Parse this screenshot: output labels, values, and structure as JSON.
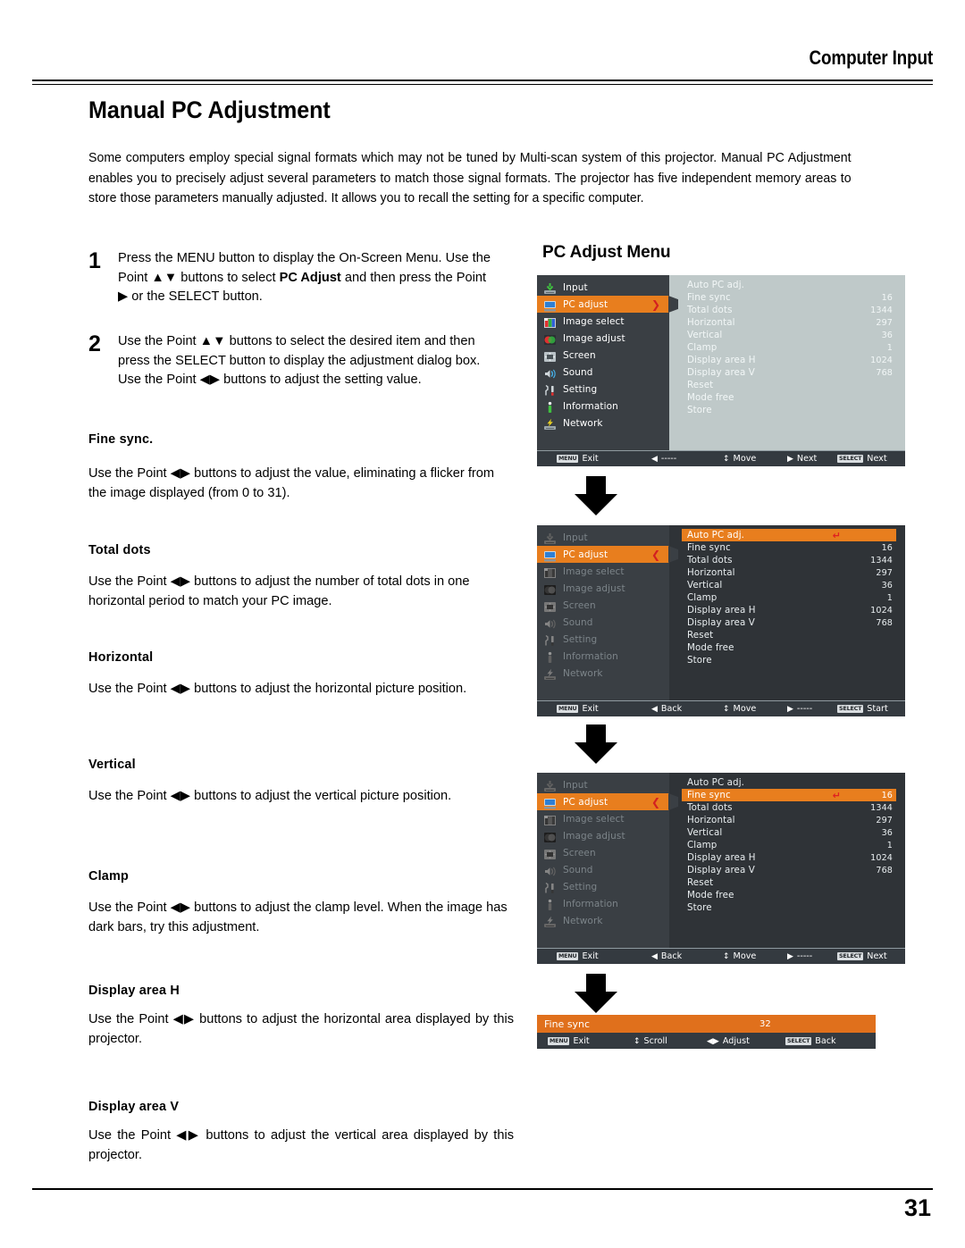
{
  "header": {
    "title": "Computer Input"
  },
  "page": {
    "main_title": "Manual PC Adjustment",
    "number": "31"
  },
  "intro": "Some computers employ special signal formats which may not be tuned by Multi-scan system of this projector. Manual PC Adjustment enables you to precisely adjust several parameters to match those signal formats. The projector has five independent memory areas to store those parameters manually adjusted. It allows you to recall the setting for a specific computer.",
  "steps": [
    {
      "number": "1",
      "part1": "Press the MENU button to display the On-Screen Menu. Use the Point ",
      "glyph1": "▲▼",
      "part2": " buttons to select ",
      "bold": "PC Adjust",
      "part3": " and then press the Point ",
      "glyph2": "▶",
      "part4": " or the SELECT button."
    },
    {
      "number": "2",
      "part1": "Use the Point ",
      "glyph1": "▲▼",
      "part2": " buttons to select  the desired item and then press the SELECT button to display the adjustment dialog box. Use the Point ",
      "glyph2": "◀▶",
      "part3": " buttons to adjust the setting value."
    }
  ],
  "sections": [
    {
      "heading": "Fine sync.",
      "pre": "Use the Point ",
      "glyph": "◀▶",
      "post": " buttons to adjust the value, eliminating a flicker from the image displayed (from 0 to 31)."
    },
    {
      "heading": "Total dots",
      "pre": "Use the Point ",
      "glyph": "◀▶",
      "post": " buttons to adjust the number of total dots in one horizontal period to match your PC image."
    },
    {
      "heading": "Horizontal",
      "pre": "Use the Point ",
      "glyph": "◀▶",
      "post": " buttons to adjust the horizontal picture position."
    },
    {
      "heading": "Vertical",
      "pre": "Use the Point ",
      "glyph": "◀▶",
      "post": " buttons to adjust the vertical picture position."
    },
    {
      "heading": "Clamp",
      "pre": "Use the Point ",
      "glyph": "◀▶",
      "post": " buttons to adjust the clamp level. When the image has dark bars, try this adjustment."
    },
    {
      "heading": "Display area H",
      "pre": "Use the Point ",
      "glyph": "◀▶",
      "post": " buttons to adjust the horizontal area displayed by this projector."
    },
    {
      "heading": "Display area V",
      "pre": "Use the Point ",
      "glyph": "◀▶",
      "post": " buttons to adjust the vertical area displayed by this projector."
    }
  ],
  "osd": {
    "title": "PC Adjust Menu",
    "sidebar_items": [
      {
        "label": "Input",
        "icon": "input-icon"
      },
      {
        "label": "PC adjust",
        "icon": "pc-adjust-icon"
      },
      {
        "label": "Image select",
        "icon": "image-select-icon"
      },
      {
        "label": "Image adjust",
        "icon": "image-adjust-icon"
      },
      {
        "label": "Screen",
        "icon": "screen-icon"
      },
      {
        "label": "Sound",
        "icon": "sound-icon"
      },
      {
        "label": "Setting",
        "icon": "setting-icon"
      },
      {
        "label": "Information",
        "icon": "information-icon"
      },
      {
        "label": "Network",
        "icon": "network-icon"
      }
    ],
    "items": [
      {
        "label": "Auto PC adj.",
        "value": ""
      },
      {
        "label": "Fine sync",
        "value": "16"
      },
      {
        "label": "Total dots",
        "value": "1344"
      },
      {
        "label": "Horizontal",
        "value": "297"
      },
      {
        "label": "Vertical",
        "value": "36"
      },
      {
        "label": "Clamp",
        "value": "1"
      },
      {
        "label": "Display area H",
        "value": "1024"
      },
      {
        "label": "Display area V",
        "value": "768"
      },
      {
        "label": "Reset",
        "value": ""
      },
      {
        "label": "Mode free",
        "value": ""
      },
      {
        "label": "Store",
        "value": ""
      }
    ],
    "panel1": {
      "foot": {
        "menu_key": "MENU",
        "exit": "Exit",
        "left_glyph": "◀",
        "left_label": "-----",
        "move_glyph": "↕",
        "move": "Move",
        "right_glyph": "▶",
        "right_label": "Next",
        "select_key": "SELECT",
        "select_label": "Next"
      }
    },
    "panel2": {
      "foot": {
        "menu_key": "MENU",
        "exit": "Exit",
        "left_glyph": "◀",
        "left_label": "Back",
        "move_glyph": "↕",
        "move": "Move",
        "right_glyph": "▶",
        "right_label": "-----",
        "select_key": "SELECT",
        "select_label": "Start"
      }
    },
    "panel3": {
      "foot": {
        "menu_key": "MENU",
        "exit": "Exit",
        "left_glyph": "◀",
        "left_label": "Back",
        "move_glyph": "↕",
        "move": "Move",
        "right_glyph": "▶",
        "right_label": "-----",
        "select_key": "SELECT",
        "select_label": "Next"
      }
    },
    "dialog": {
      "label": "Fine sync",
      "value": "32",
      "foot": {
        "menu_key": "MENU",
        "exit": "Exit",
        "scroll_glyph": "↕",
        "scroll": "Scroll",
        "adjust_glyph": "◀▶",
        "adjust": "Adjust",
        "select_key": "SELECT",
        "select_label": "Back"
      }
    },
    "colors": {
      "highlight": "#e87e1e",
      "caret": "#e02020",
      "panel_dark": "#2f3337",
      "sidebar": "#3a3f44",
      "dim_panel": "#bfc9c9"
    }
  }
}
